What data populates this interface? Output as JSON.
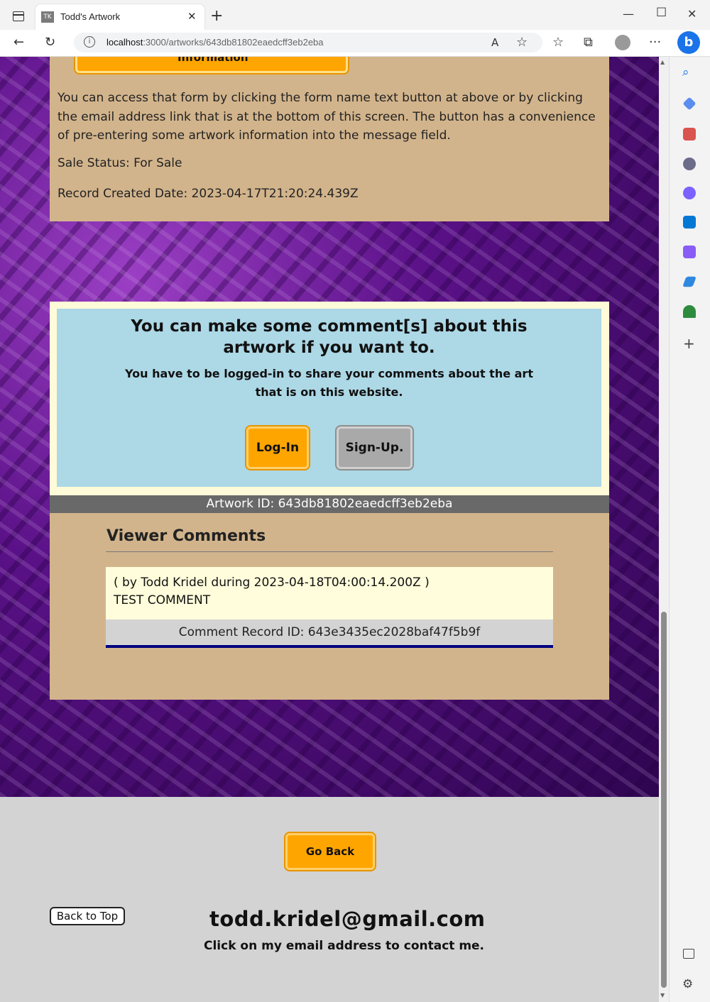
{
  "browser": {
    "tab_title": "Todd's Artwork",
    "tab_favicon": "TK",
    "url_host": "localhost",
    "url_rest": ":3000/artworks/643db81802eaedcff3eb2eba"
  },
  "info": {
    "partial_button_label": "Information",
    "paragraph": "You can access that form by clicking the form name text button at above or by clicking the email address link that is at the bottom of this screen. The button has a convenience of pre-entering some artwork information into the message field.",
    "sale_status": "Sale Status: For Sale",
    "record_created": "Record Created Date: 2023-04-17T21:20:24.439Z"
  },
  "comment_prompt": {
    "heading": "You can make some comment[s] about this artwork if you want to.",
    "subtext": "You have to be logged-in to share your comments about the art that is on this website.",
    "login_label": "Log-In",
    "signup_label": "Sign-Up."
  },
  "artwork_id_label": "Artwork ID: 643db81802eaedcff3eb2eba",
  "viewer_comments": {
    "title": "Viewer Comments",
    "comments": [
      {
        "meta": "( by Todd Kridel during 2023-04-18T04:00:14.200Z )",
        "text": "TEST COMMENT",
        "record_id": "Comment Record ID: 643e3435ec2028baf47f5b9f"
      }
    ]
  },
  "footer": {
    "go_back_label": "Go Back",
    "back_to_top_label": "Back to Top",
    "email": "todd.kridel@gmail.com",
    "email_hint": "Click on my email address to contact me."
  },
  "colors": {
    "panel_tan": "#d2b48c",
    "button_orange": "#ffa500",
    "comment_blue": "#add8e6",
    "id_bar_grey": "#696969",
    "comment_id_border": "#000080"
  }
}
